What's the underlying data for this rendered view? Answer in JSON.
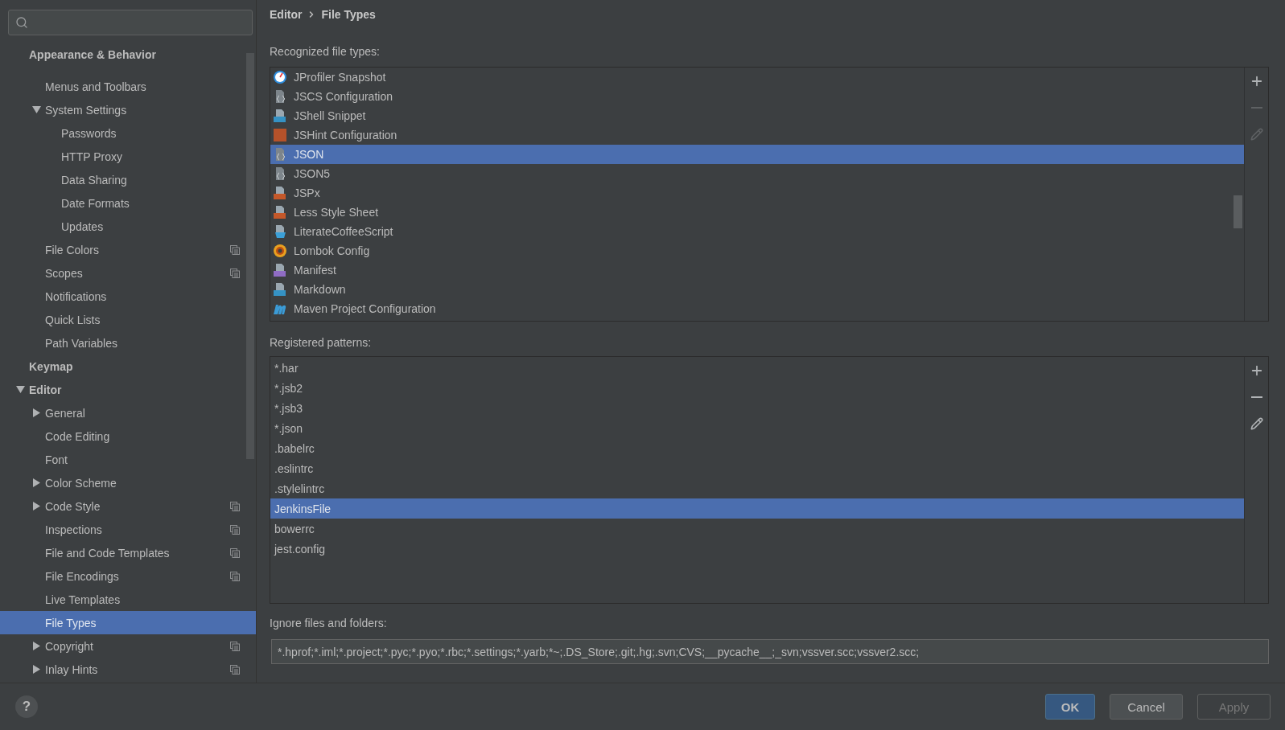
{
  "sidebar": {
    "tree": [
      {
        "label": "Appearance & Behavior",
        "kind": "pinned",
        "children": [
          {
            "label": "Menus and Toolbars",
            "selected": false
          },
          {
            "label": "System Settings",
            "selected": false,
            "expanded": true,
            "children": [
              {
                "label": "Passwords",
                "selected": false
              },
              {
                "label": "HTTP Proxy",
                "selected": false
              },
              {
                "label": "Data Sharing",
                "selected": false
              },
              {
                "label": "Date Formats",
                "selected": false
              },
              {
                "label": "Updates",
                "selected": false
              }
            ]
          },
          {
            "label": "File Colors",
            "selected": false,
            "project_level": true
          },
          {
            "label": "Scopes",
            "selected": false,
            "project_level": true
          },
          {
            "label": "Notifications",
            "selected": false
          },
          {
            "label": "Quick Lists",
            "selected": false
          },
          {
            "label": "Path Variables",
            "selected": false
          }
        ]
      },
      {
        "label": "Keymap",
        "kind": "node",
        "selected": false
      },
      {
        "label": "Editor",
        "kind": "node",
        "selected": false,
        "expanded": true,
        "children": [
          {
            "label": "General",
            "selected": false,
            "expanded": false
          },
          {
            "label": "Code Editing",
            "selected": false
          },
          {
            "label": "Font",
            "selected": false
          },
          {
            "label": "Color Scheme",
            "selected": false,
            "expanded": false
          },
          {
            "label": "Code Style",
            "selected": false,
            "expanded": false,
            "project_level": true
          },
          {
            "label": "Inspections",
            "selected": false,
            "project_level": true
          },
          {
            "label": "File and Code Templates",
            "selected": false,
            "project_level": true
          },
          {
            "label": "File Encodings",
            "selected": false,
            "project_level": true
          },
          {
            "label": "Live Templates",
            "selected": false
          },
          {
            "label": "File Types",
            "selected": true
          },
          {
            "label": "Copyright",
            "selected": false,
            "expanded": false,
            "project_level": true
          },
          {
            "label": "Inlay Hints",
            "selected": false,
            "expanded": false,
            "project_level": true
          }
        ]
      }
    ]
  },
  "breadcrumb": [
    "Editor",
    "File Types"
  ],
  "file_types": {
    "label": "Recognized file types:",
    "items": [
      {
        "label": "JProfiler Snapshot",
        "kind": "gauge",
        "selected": false
      },
      {
        "label": "JSCS Configuration",
        "kind": "config",
        "selected": false
      },
      {
        "label": "JShell Snippet",
        "kind": "jshell",
        "selected": false
      },
      {
        "label": "JSHint Configuration",
        "kind": "jshint",
        "selected": false
      },
      {
        "label": "JSON",
        "kind": "config",
        "selected": true
      },
      {
        "label": "JSON5",
        "kind": "config",
        "selected": false
      },
      {
        "label": "JSPx",
        "kind": "jsx",
        "selected": false
      },
      {
        "label": "Less Style Sheet",
        "kind": "less",
        "selected": false
      },
      {
        "label": "LiterateCoffeeScript",
        "kind": "coffee",
        "selected": false
      },
      {
        "label": "Lombok Config",
        "kind": "gear",
        "selected": false
      },
      {
        "label": "Manifest",
        "kind": "manifest",
        "selected": false
      },
      {
        "label": "Markdown",
        "kind": "markdown",
        "selected": false
      },
      {
        "label": "Maven Project Configuration",
        "kind": "maven",
        "selected": false
      }
    ],
    "toolbar": [
      {
        "kind": "add",
        "disabled": false
      },
      {
        "kind": "remove",
        "disabled": true
      },
      {
        "kind": "edit",
        "disabled": true
      }
    ]
  },
  "patterns": {
    "label": "Registered patterns:",
    "items": [
      {
        "label": "*.har",
        "selected": false
      },
      {
        "label": "*.jsb2",
        "selected": false
      },
      {
        "label": "*.jsb3",
        "selected": false
      },
      {
        "label": "*.json",
        "selected": false
      },
      {
        "label": ".babelrc",
        "selected": false
      },
      {
        "label": ".eslintrc",
        "selected": false
      },
      {
        "label": ".stylelintrc",
        "selected": false
      },
      {
        "label": "JenkinsFile",
        "selected": true
      },
      {
        "label": "bowerrc",
        "selected": false
      },
      {
        "label": "jest.config",
        "selected": false
      }
    ],
    "toolbar": [
      {
        "kind": "add",
        "disabled": false
      },
      {
        "kind": "remove",
        "disabled": false
      },
      {
        "kind": "edit",
        "disabled": false
      }
    ]
  },
  "ignore": {
    "label": "Ignore files and folders:",
    "value": "*.hprof;*.iml;*.project;*.pyc;*.pyo;*.rbc;*.settings;*.yarb;*~;.DS_Store;.git;.hg;.svn;CVS;__pycache__;_svn;vssver.scc;vssver2.scc;"
  },
  "footer": {
    "help": "?",
    "buttons": [
      {
        "label": "OK",
        "kind": "primary",
        "disabled": false
      },
      {
        "label": "Cancel",
        "kind": "normal",
        "disabled": false
      },
      {
        "label": "Apply",
        "kind": "normal",
        "disabled": true
      }
    ]
  }
}
